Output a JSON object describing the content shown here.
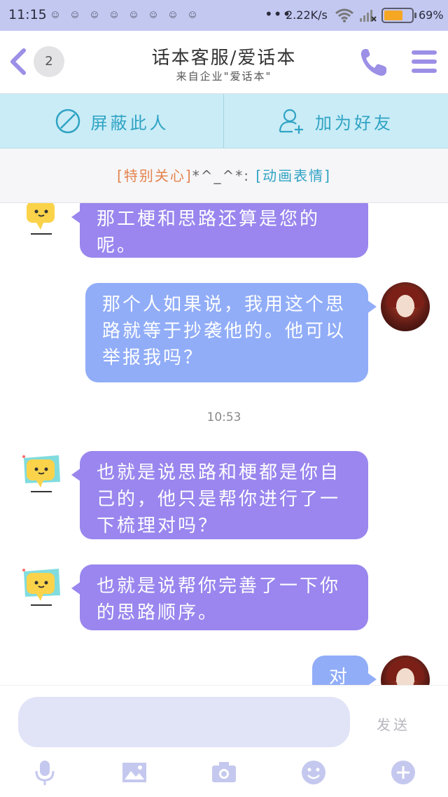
{
  "status_bar": {
    "time": "11:15",
    "network_speed": "2.22K/s",
    "battery_percent": "69%",
    "battery_level": 0.69,
    "dots": "•••"
  },
  "header": {
    "badge_count": "2",
    "title": "话本客服/爱话本",
    "subtitle": "来自企业\"爱话本\""
  },
  "actions": {
    "block_label": "屏蔽此人",
    "add_friend_label": "加为好友"
  },
  "tip": {
    "highlight": "[特别关心]",
    "middle": "*^_^*: ",
    "link": "[动画表情]"
  },
  "messages": [
    {
      "side": "left",
      "text": "那工梗和思路还算是您的呢。"
    },
    {
      "side": "right",
      "text": "那个人如果说，我用这个思路就等于抄袭他的。他可以举报我吗？"
    },
    {
      "side": "time",
      "text": "10:53"
    },
    {
      "side": "left",
      "text": "也就是说思路和梗都是你自己的，他只是帮你进行了一下梳理对吗？"
    },
    {
      "side": "left",
      "text": "也就是说帮你完善了一下你的思路顺序。"
    },
    {
      "side": "right",
      "text": "对"
    }
  ],
  "input": {
    "value": "",
    "send_label": "发送"
  },
  "colors": {
    "accent": "#9b8fe6",
    "bot_bubble": "#9a86ee",
    "user_bubble": "#91adf8",
    "action_bar": "#c9ecf6",
    "action_text": "#2fa3c4",
    "tip_highlight": "#e4834e"
  },
  "icons": [
    "back-icon",
    "phone-icon",
    "menu-icon",
    "block-icon",
    "add-friend-icon",
    "microphone-icon",
    "image-icon",
    "camera-icon",
    "emoji-icon",
    "plus-icon"
  ]
}
